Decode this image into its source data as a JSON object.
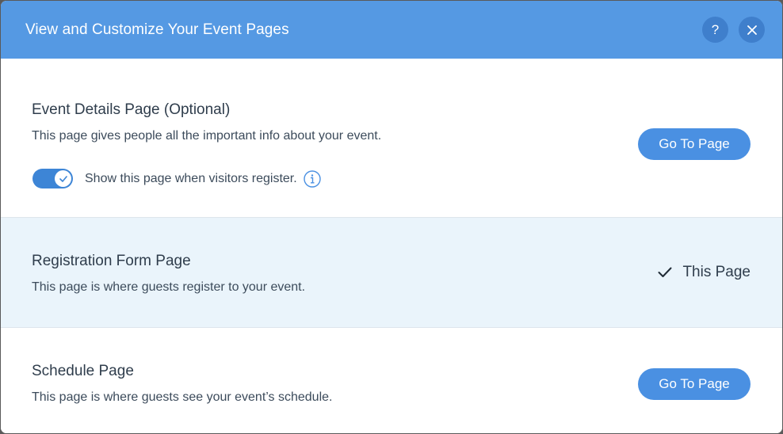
{
  "dialog": {
    "title": "View and Customize Your Event Pages",
    "help_icon": "question-mark-icon",
    "close_icon": "close-icon"
  },
  "sections": [
    {
      "title": "Event Details Page (Optional)",
      "description": "This page gives people all the important info about your event.",
      "toggle": {
        "label": "Show this page when visitors register.",
        "checked": true,
        "info_icon": "info-icon"
      },
      "action_label": "Go To Page"
    },
    {
      "title": "Registration Form Page",
      "description": "This page is where guests register to your event.",
      "current_label": "This Page",
      "current_icon": "checkmark-icon"
    },
    {
      "title": "Schedule Page",
      "description": "This page is where guests see your event’s schedule.",
      "action_label": "Go To Page"
    }
  ],
  "colors": {
    "header": "#5599e3",
    "primary_button": "#4a90e2",
    "selected_row": "#eaf4fb",
    "text_dark": "#2f3d4c"
  }
}
